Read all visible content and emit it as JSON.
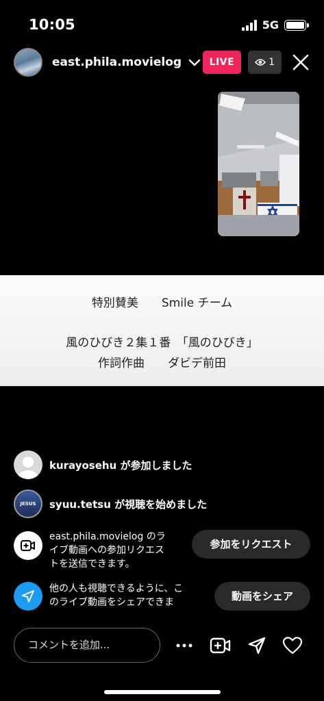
{
  "status_bar": {
    "time": "10:05",
    "network": "5G"
  },
  "header": {
    "username": "east.phila.movielog",
    "live_label": "LIVE",
    "viewer_count": "1"
  },
  "banner": {
    "line1": "特別賛美　　Smile チーム",
    "line2": "風のひびき２集１番　「風のひびき」",
    "line3": "作詞作曲　　ダビデ前田"
  },
  "activity": [
    {
      "text": "kurayosehu が参加しました"
    },
    {
      "text": "syuu.tetsu が視聴を始めました",
      "avatar_label": "JESUS"
    }
  ],
  "join_request": {
    "lines": [
      "east.phila.movielog のラ",
      "イブ動画への参加リクエス",
      "トを送信できます。"
    ],
    "button": "参加をリクエスト"
  },
  "share": {
    "lines": [
      "他の人も視聴できるように、こ",
      "のライブ動画をシェアできま"
    ],
    "button": "動画をシェア",
    "accent": "#1d9bf0"
  },
  "bottom": {
    "comment_placeholder": "コメントを追加..."
  },
  "colors": {
    "live": "#f0245a",
    "background": "#000000"
  }
}
